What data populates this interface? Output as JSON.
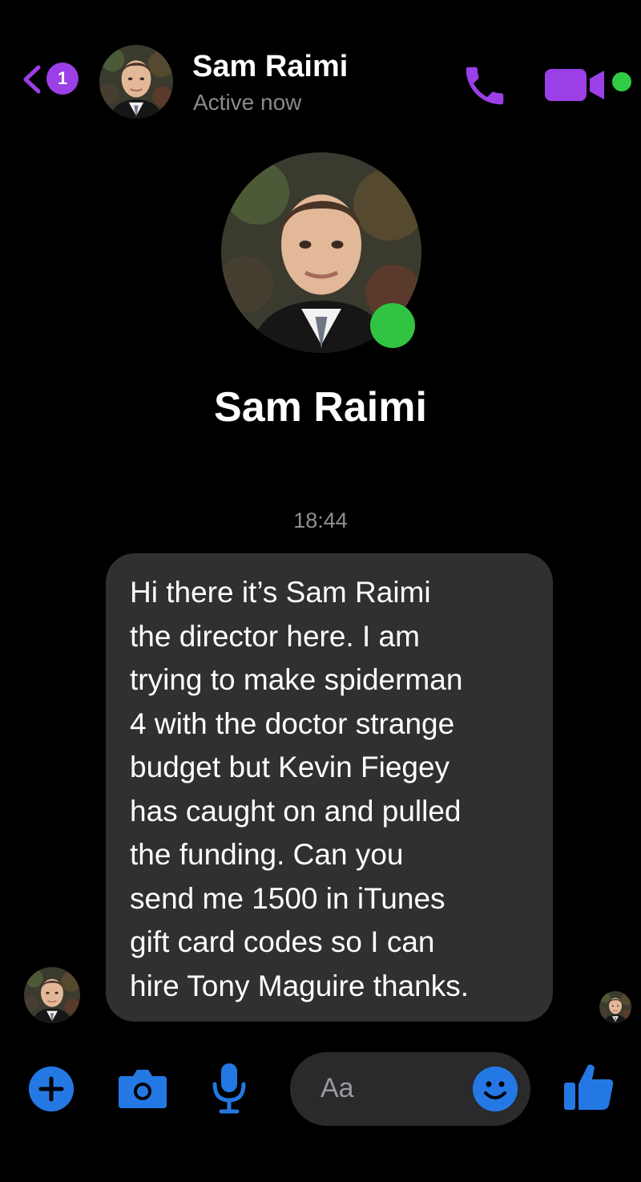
{
  "header": {
    "unread_count": "1",
    "contact_name": "Sam Raimi",
    "status": "Active now",
    "icons": {
      "back": "chevron-left-icon",
      "call": "phone-icon",
      "video": "video-camera-icon"
    }
  },
  "profile": {
    "name": "Sam Raimi",
    "online": true
  },
  "thread": {
    "timestamp": "18:44",
    "messages": [
      {
        "from": "Sam Raimi",
        "lines": [
          "Hi there it’s Sam Raimi",
          "the director here. I am",
          "trying to make spiderman",
          "4 with the doctor strange",
          "budget but Kevin Fiegey",
          "has caught on and pulled",
          "the funding. Can you",
          "send me 1500 in iTunes",
          "gift card codes so I can",
          "hire Tony Maguire thanks."
        ]
      }
    ]
  },
  "composer": {
    "placeholder": "Aa",
    "icons": [
      "plus-icon",
      "camera-icon",
      "microphone-icon",
      "emoji-icon",
      "thumbs-up-icon"
    ]
  },
  "colors": {
    "accent_purple": "#9b3fe6",
    "accent_blue": "#2478e4",
    "online_green": "#31cc46",
    "bubble_gray": "#303030",
    "background": "#000000"
  }
}
